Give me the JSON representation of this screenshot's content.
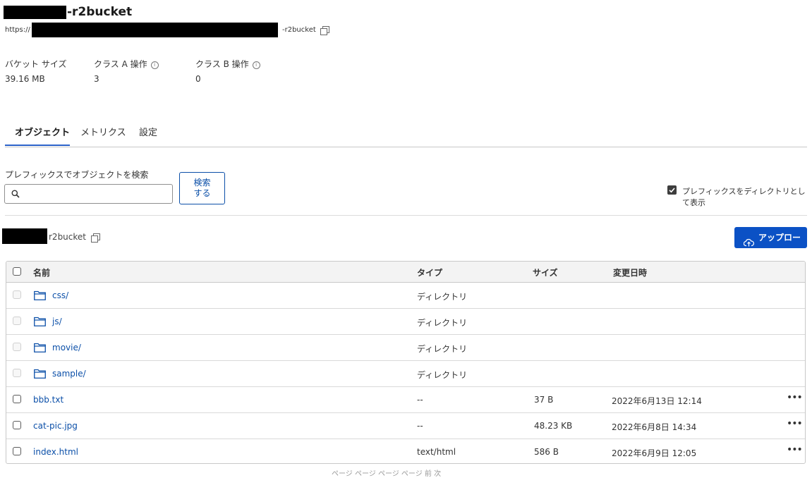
{
  "header": {
    "bucket_title": "-r2bucket",
    "url_prefix": "https://",
    "url_suffix": "-r2bucket",
    "copy_icon": "copy-icon"
  },
  "stats": {
    "bucket_size": {
      "label": "バケット サイズ",
      "value": "39.16 MB"
    },
    "class_a": {
      "label": "クラス A 操作",
      "value": "3"
    },
    "class_b": {
      "label": "クラス B 操作",
      "value": "0"
    },
    "info_icon": "info-icon"
  },
  "tabs": [
    {
      "label": "オブジェクト",
      "active": true
    },
    {
      "label": "メトリクス",
      "active": false
    },
    {
      "label": "設定",
      "active": false
    }
  ],
  "search": {
    "label": "プレフィックスでオブジェクトを検索",
    "value": "",
    "placeholder": "",
    "button_line1": "検索",
    "button_line2": "する",
    "icon": "search-icon"
  },
  "prefix_toggle": {
    "label": "プレフィックスをディレクトリとして表示",
    "checked": true
  },
  "path": {
    "label": "r2bucket",
    "copy_icon": "copy-icon"
  },
  "upload": {
    "label": "アップロード",
    "icon": "upload-cloud-icon",
    "color": "#0b51c5"
  },
  "table": {
    "columns": [
      "名前",
      "タイプ",
      "サイズ",
      "変更日時"
    ],
    "rows": [
      {
        "name": "css/",
        "type": "ディレクトリ",
        "size": "",
        "modified": "",
        "is_folder": true
      },
      {
        "name": "js/",
        "type": "ディレクトリ",
        "size": "",
        "modified": "",
        "is_folder": true
      },
      {
        "name": "movie/",
        "type": "ディレクトリ",
        "size": "",
        "modified": "",
        "is_folder": true
      },
      {
        "name": "sample/",
        "type": "ディレクトリ",
        "size": "",
        "modified": "",
        "is_folder": true
      },
      {
        "name": "bbb.txt",
        "type": "--",
        "size": "37 B",
        "modified": "2022年6月13日 12:14",
        "is_folder": false
      },
      {
        "name": "cat-pic.jpg",
        "type": "--",
        "size": "48.23 KB",
        "modified": "2022年6月8日 14:34",
        "is_folder": false
      },
      {
        "name": "index.html",
        "type": "text/html",
        "size": "586 B",
        "modified": "2022年6月9日 12:05",
        "is_folder": false
      }
    ],
    "more_label": "•••"
  },
  "footer": {
    "text": "ページ ページ ページ ページ 前 次"
  },
  "colors": {
    "accent": "#0b51c5",
    "link": "#0b4fa8",
    "tab_underline": "#2b62c9"
  }
}
